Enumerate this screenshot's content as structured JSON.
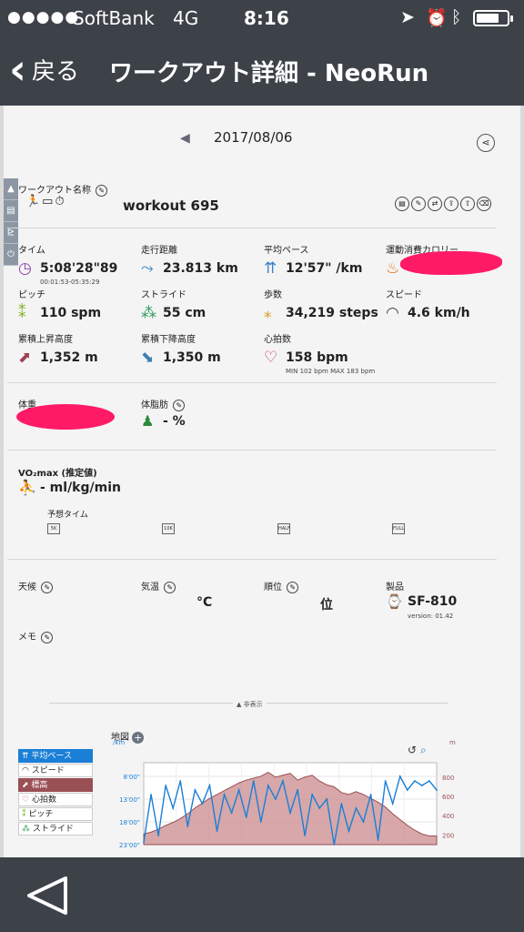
{
  "status_bar": {
    "signal_dots": "●●●●●",
    "carrier": "SoftBank",
    "network": "4G",
    "time": "8:16",
    "location_icon": "location-arrow-icon",
    "alarm_icon": "alarm-clock-icon",
    "bluetooth_icon": "bluetooth-icon",
    "battery_level": 0.75
  },
  "nav": {
    "back_label": "戻る",
    "title": "ワークアウト詳細 - NeoRun"
  },
  "date_bar": {
    "prev_symbol": "◀",
    "date": "2017/08/06"
  },
  "side_tabs": [
    "▲",
    "▤",
    "⊵",
    "⏻"
  ],
  "workout": {
    "name_label": "ワークアウト名称",
    "name_value": "workout 695",
    "type_icons": "🏃▭⏱"
  },
  "stats": {
    "time": {
      "label": "タイム",
      "value": "5:08'28\"89",
      "sub": "00:01:53-05:35:29"
    },
    "distance": {
      "label": "走行距離",
      "value": "23.813 km"
    },
    "avg_pace": {
      "label": "平均ペース",
      "value": "12'57\" /km"
    },
    "calories": {
      "label": "運動消費カロリー"
    },
    "pitch": {
      "label": "ピッチ",
      "value": "110 spm"
    },
    "stride": {
      "label": "ストライド",
      "value": "55 cm"
    },
    "steps": {
      "label": "歩数",
      "value": "34,219 steps"
    },
    "speed": {
      "label": "スピード",
      "value": "4.6 km/h"
    },
    "ascent": {
      "label": "累積上昇高度",
      "value": "1,352 m"
    },
    "descent": {
      "label": "累積下降高度",
      "value": "1,350 m"
    },
    "heart_rate": {
      "label": "心拍数",
      "value": "158 bpm",
      "sub": "MIN 102 bpm MAX 183 bpm"
    }
  },
  "body": {
    "weight_label": "体重",
    "body_fat_label": "体脂肪",
    "body_fat_value": "- %"
  },
  "vo2": {
    "label": "VO₂max (推定値)",
    "value": "- ml/kg/min",
    "predicted_label": "予想タイム",
    "predicted_icons": [
      "5K",
      "10K",
      "HALF",
      "FULL"
    ]
  },
  "conditions": {
    "weather_label": "天候",
    "temp_label": "気温",
    "temp_unit": "°C",
    "rank_label": "順位",
    "rank_unit": "位",
    "product_label": "製品",
    "product_value": "SF-810",
    "version": "version: 01.42",
    "memo_label": "メモ"
  },
  "hide_toggle": "▲ 非表示",
  "map_label": "地図",
  "legend": [
    "平均ペース",
    "スピード",
    "標高",
    "心拍数",
    "ピッチ",
    "ストライド"
  ],
  "colors": {
    "header": "#3d4249",
    "pace_blue": "#1a7fd6",
    "elevation": "#9a4f55",
    "redaction": "#ff1a66"
  },
  "chart_data": {
    "type": "area",
    "x": [
      0,
      1,
      2,
      3,
      4,
      5,
      6,
      7,
      8,
      9,
      10,
      11,
      12,
      13,
      14,
      15,
      16,
      17,
      18,
      19,
      20,
      21,
      22,
      23,
      24,
      25,
      26,
      27,
      28,
      29,
      30,
      31,
      32,
      33,
      34,
      35,
      36,
      37,
      38,
      39,
      40
    ],
    "series": [
      {
        "name": "平均ペース",
        "unit": "/km",
        "values": [
          22.5,
          12,
          21,
          10,
          15,
          9,
          19,
          11,
          14,
          10,
          20,
          12,
          16,
          11,
          17,
          9,
          18,
          10,
          13,
          9,
          16,
          11,
          21,
          12,
          15,
          13,
          23,
          14,
          20,
          15,
          18,
          12,
          22,
          9,
          14,
          8,
          11,
          9,
          10,
          9,
          11
        ]
      },
      {
        "name": "標高",
        "unit": "m",
        "values": [
          210,
          230,
          260,
          300,
          330,
          370,
          420,
          480,
          530,
          580,
          620,
          660,
          700,
          740,
          770,
          790,
          810,
          850,
          800,
          820,
          840,
          770,
          800,
          820,
          760,
          720,
          700,
          640,
          620,
          650,
          620,
          580,
          540,
          490,
          420,
          360,
          300,
          250,
          210,
          190,
          190
        ]
      }
    ],
    "left_axis": {
      "unit": "/km",
      "ticks": [
        "8'00\"",
        "13'00\"",
        "18'00\"",
        "23'00\""
      ],
      "inverted": true,
      "range": [
        23,
        5
      ]
    },
    "right_axis": {
      "unit": "m",
      "ticks": [
        "800",
        "600",
        "400",
        "200"
      ],
      "range": [
        100,
        950
      ]
    }
  }
}
